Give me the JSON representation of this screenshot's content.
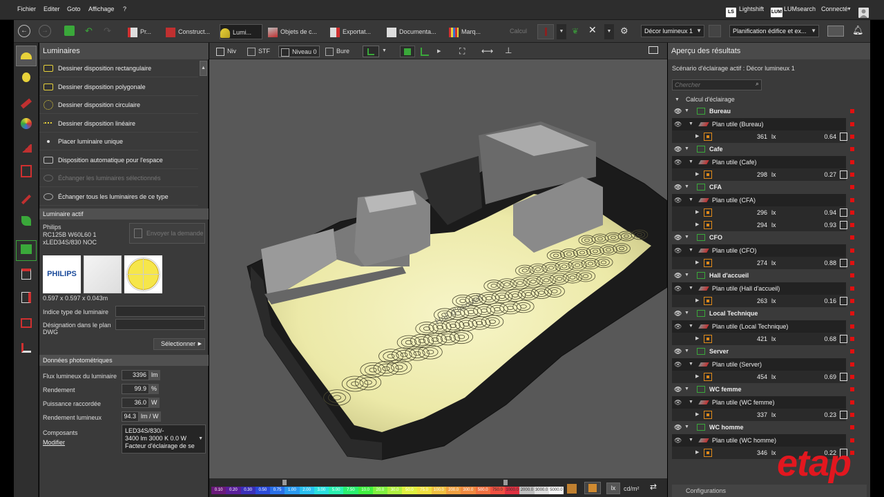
{
  "menu": [
    "Fichier",
    "Editer",
    "Goto",
    "Affichage",
    "?"
  ],
  "topright": {
    "lightshift": "Lightshift",
    "lumsearch": "LUMsearch",
    "connect": "Connecté",
    "ls_badge": "LS",
    "lum_badge": "LUM"
  },
  "toolbar": {
    "tabs": [
      "Pr...",
      "Construct...",
      "Lumi...",
      "Objets de c...",
      "Exportat...",
      "Documenta...",
      "Marq..."
    ],
    "calc_label": "Calcul",
    "scene_select": "Décor lumineux 1",
    "plan_select": "Planification édifice et ex..."
  },
  "left": {
    "title": "Luminaires",
    "items": [
      "Dessiner disposition rectangulaire",
      "Dessiner disposition polygonale",
      "Dessiner disposition circulaire",
      "Dessiner disposition linéaire",
      "Placer luminaire unique",
      "Disposition automatique pour l'espace",
      "Échanger les luminaires sélectionnés",
      "Échanger tous les luminaires de ce type"
    ],
    "active_title": "Luminaire actif",
    "lum_name": "Philips",
    "lum_ref1": "RC125B W60L60 1",
    "lum_ref2": "xLED34S/830 NOC",
    "send_request": "Envoyer la demande",
    "logo_text": "PHILIPS",
    "dims": "0.597 x 0.597 x 0.043m",
    "type_index_label": "Indice type de luminaire",
    "dwg_label1": "Désignation dans le plan",
    "dwg_label2": "DWG",
    "select_btn": "Sélectionner",
    "photo_title": "Données photométriques",
    "flux_label": "Flux lumineux du luminaire",
    "flux_val": "3396",
    "flux_unit": "lm",
    "rend_label": "Rendement",
    "rend_val": "99.9",
    "rend_unit": "%",
    "power_label": "Puissance raccordée",
    "power_val": "36.0",
    "power_unit": "W",
    "eff_label": "Rendement lumineux",
    "eff_val": "94.3",
    "eff_unit": "lm / W",
    "comp_label": "Composants",
    "modify": "Modifier",
    "comp_line1": "LED34S/830/-",
    "comp_line2": "3400 lm  3000 K  0.0 W",
    "comp_line3": "Facteur d'éclairage de se"
  },
  "viewport": {
    "tabs": [
      "Niv",
      "STF",
      "Niveau 0",
      "Bure"
    ],
    "label_hall": "Hall d'accueil",
    "legend_values": [
      "0.10",
      "0.20",
      "0.30",
      "0.50",
      "0.75",
      "1.00",
      "2.00",
      "3.00",
      "5.00",
      "7.50",
      "10.0",
      "20.0",
      "30.0",
      "50.0",
      "75.0",
      "100.0",
      "200.0",
      "300.0",
      "500.0",
      "750.0",
      "1000.0",
      "2000.0",
      "3000.0",
      "5000.0"
    ],
    "legend_colors": [
      "#6a1a7a",
      "#5a1f9a",
      "#3a2fb8",
      "#2a4ad8",
      "#2a70e8",
      "#2a9af0",
      "#2ac0f0",
      "#2ae0e0",
      "#2af0b0",
      "#2af070",
      "#40f040",
      "#80f040",
      "#b0f040",
      "#e0f040",
      "#f0e040",
      "#f0c040",
      "#f0a040",
      "#f08a40",
      "#f07040",
      "#f05040",
      "#e03040",
      "#c0c0c0",
      "#e0e0e0",
      "#f8f8f8"
    ],
    "unit_lx": "lx",
    "unit_cd": "cd/m²"
  },
  "right": {
    "title": "Aperçu des résultats",
    "scenario": "Scénario d'éclairage actif : Décor lumineux 1",
    "search_placeholder": "Chercher",
    "calc_title": "Calcul d'éclairage",
    "unit": "lx",
    "groups": [
      {
        "name": "Bureau",
        "plan": "Plan utile (Bureau)",
        "rows": [
          [
            "361",
            "0.64"
          ]
        ]
      },
      {
        "name": "Cafe",
        "plan": "Plan utile (Cafe)",
        "rows": [
          [
            "298",
            "0.27"
          ]
        ]
      },
      {
        "name": "CFA",
        "plan": "Plan utile (CFA)",
        "rows": [
          [
            "296",
            "0.94"
          ],
          [
            "294",
            "0.93"
          ]
        ]
      },
      {
        "name": "CFO",
        "plan": "Plan utile (CFO)",
        "rows": [
          [
            "274",
            "0.88"
          ]
        ]
      },
      {
        "name": "Hall d'accueil",
        "plan": "Plan utile (Hall d'accueil)",
        "rows": [
          [
            "263",
            "0.16"
          ]
        ]
      },
      {
        "name": "Local Technique",
        "plan": "Plan utile (Local Technique)",
        "rows": [
          [
            "421",
            "0.68"
          ]
        ]
      },
      {
        "name": "Server",
        "plan": "Plan utile (Server)",
        "rows": [
          [
            "454",
            "0.69"
          ]
        ]
      },
      {
        "name": "WC femme",
        "plan": "Plan utile (WC femme)",
        "rows": [
          [
            "337",
            "0.23"
          ]
        ]
      },
      {
        "name": "WC homme",
        "plan": "Plan utile (WC homme)",
        "rows": [
          [
            "346",
            "0.22"
          ]
        ]
      }
    ],
    "footer": "Configurations"
  },
  "brand": "etap",
  "colors": {
    "accent": "#e08a1a",
    "status_red": "#e01010",
    "brand_red": "#e2171f",
    "floor": "#ece9b0"
  }
}
